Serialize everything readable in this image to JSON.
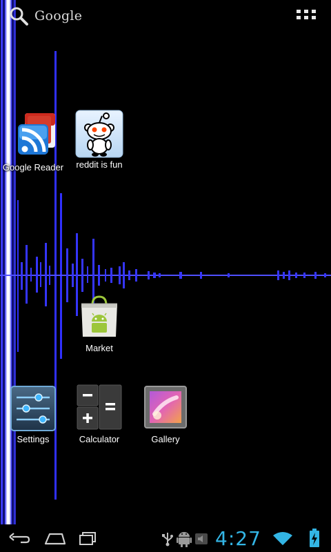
{
  "search": {
    "label": "Google"
  },
  "shortcuts": [
    {
      "label": "Google Reader",
      "icon": "google-reader-icon"
    },
    {
      "label": "reddit is fun",
      "icon": "reddit-alien-icon"
    },
    {
      "label": "Market",
      "icon": "market-bag-icon"
    },
    {
      "label": "Settings",
      "icon": "settings-sliders-icon"
    },
    {
      "label": "Calculator",
      "icon": "calculator-icon"
    },
    {
      "label": "Gallery",
      "icon": "gallery-icon"
    }
  ],
  "system_bar": {
    "time": "4:27",
    "accent_color": "#33b5e5"
  },
  "colors": {
    "wallpaper_line": "#3030ff",
    "background": "#000000"
  }
}
